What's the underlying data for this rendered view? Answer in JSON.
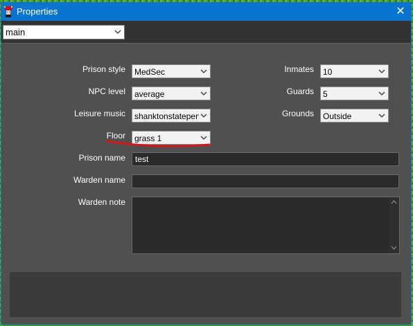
{
  "window": {
    "title": "Properties",
    "close_glyph": "✕",
    "title_bg": "#0a75d1",
    "body_bg": "#505050"
  },
  "toolbar": {
    "section_selected": "main"
  },
  "form": {
    "prison_style": {
      "label": "Prison style",
      "value": "MedSec"
    },
    "npc_level": {
      "label": "NPC level",
      "value": "average"
    },
    "leisure_music": {
      "label": "Leisure music",
      "value": "shanktonstatepen"
    },
    "floor": {
      "label": "Floor",
      "value": "grass 1"
    },
    "inmates": {
      "label": "Inmates",
      "value": "10"
    },
    "guards": {
      "label": "Guards",
      "value": "5"
    },
    "grounds": {
      "label": "Grounds",
      "value": "Outside"
    },
    "prison_name": {
      "label": "Prison name",
      "value": "test"
    },
    "warden_name": {
      "label": "Warden name",
      "value": ""
    },
    "warden_note": {
      "label": "Warden note",
      "value": ""
    }
  },
  "annotation": {
    "underline_color": "#d01818"
  },
  "icons": {
    "app": "jester-icon",
    "close": "close-icon",
    "dropdown": "chevron-down-icon",
    "scroll_up": "scroll-up-arrow-icon",
    "scroll_down": "scroll-down-arrow-icon"
  }
}
